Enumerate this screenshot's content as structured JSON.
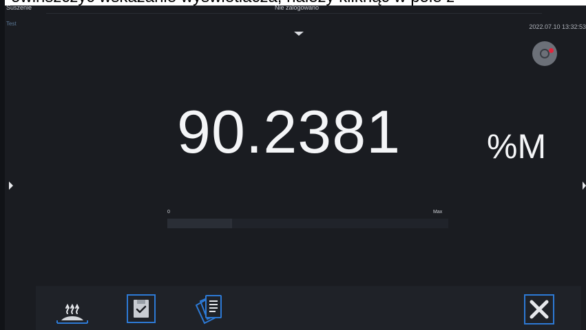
{
  "banner": {
    "text": "Powinszczyć wskazanie wyświetlacza, należy kliknąć w pole z"
  },
  "header": {
    "mode": "Suszenie",
    "submode": "Test",
    "user": "Nie zalogowano",
    "datetime": "2022.07.10 13:32:53"
  },
  "reading": {
    "value": "90.2381",
    "unit": "%M"
  },
  "bargraph": {
    "min_label": "0",
    "max_label": "Max",
    "fill_fraction": 0.23
  },
  "icons": {
    "dropdown": "chevron-down-icon",
    "record": "record-icon",
    "left": "chevron-right-icon",
    "dry": "drying-icon",
    "save": "save-check-icon",
    "reports": "reports-icon",
    "close": "close-icon"
  },
  "colors": {
    "background": "#1a1c21",
    "text": "#f4f5f7",
    "accent": "#2d7ad6",
    "record_dot": "#e2243b"
  }
}
